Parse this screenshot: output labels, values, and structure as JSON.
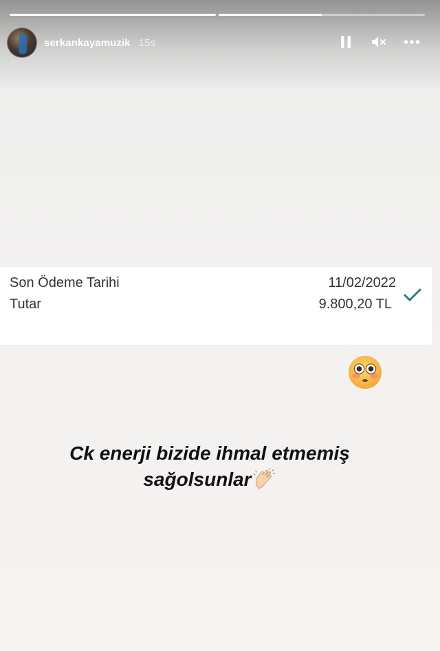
{
  "story": {
    "progress_segments": [
      1,
      0.5,
      0,
      0
    ]
  },
  "header": {
    "username": "serkankayamuzik",
    "time": "15s",
    "controls": {
      "pause_icon": "pause-icon",
      "mute_icon": "speaker-muted-icon",
      "more_icon": "more-horizontal-icon"
    }
  },
  "bill": {
    "rows": [
      {
        "label": "Son Ödeme Tarihi",
        "value": "11/02/2022"
      },
      {
        "label": "Tutar",
        "value": "9.800,20 TL"
      }
    ],
    "status_icon": "checkmark-icon",
    "accent_color": "#2a7d82"
  },
  "stickers": {
    "emoji": "flushed-face-emoji"
  },
  "caption": {
    "line1": "Ck enerji bizide ihmal etmemiş",
    "line2": "sağolsunlar",
    "emoji": "clapping-hands-emoji"
  }
}
